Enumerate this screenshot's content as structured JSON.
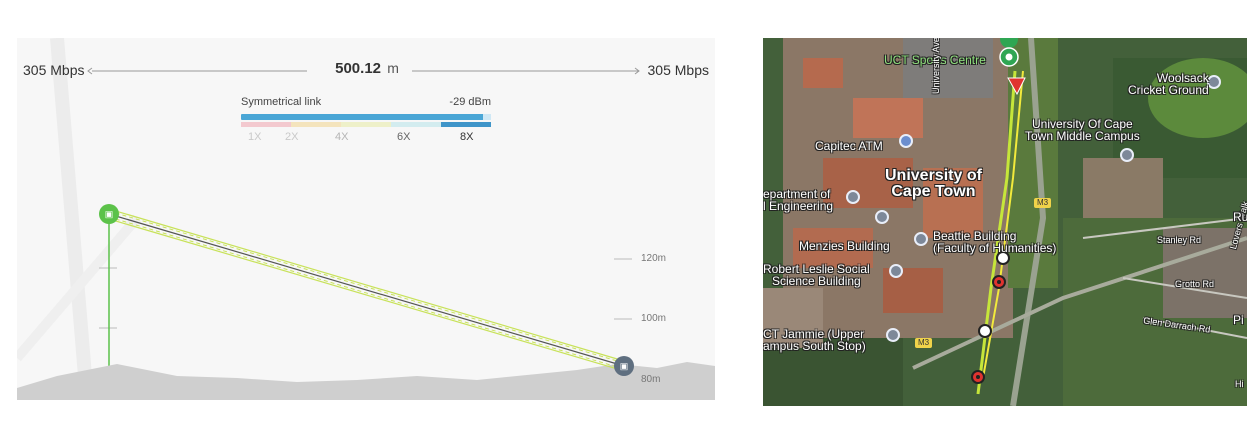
{
  "link": {
    "rate_left": "305 Mbps",
    "rate_right": "305 Mbps",
    "distance": "500.12",
    "distance_unit": "m",
    "link_type": "Symmetrical link",
    "signal": "-29 dBm",
    "modulation_levels": [
      "1X",
      "2X",
      "4X",
      "6X",
      "8X"
    ],
    "active_modulation": "8X",
    "altitude_labels": [
      "120m",
      "100m",
      "80m"
    ]
  },
  "colors": {
    "station_a": "#5cc24a",
    "station_b": "#5f6f80",
    "signal_bar": "#4aa6d6",
    "path_line": "#c8e25a"
  },
  "map": {
    "labels": {
      "sports_centre": "UCT Sports Centre",
      "woolsack": "Woolsack\nCricket Ground",
      "middle_campus": "University Of Cape\nTown Middle Campus",
      "capitec": "Capitec ATM",
      "uct": "University of\nCape Town",
      "dept": "epartment of\nl Engineering",
      "beattie": "Beattie Building\n(Faculty of Humanities)",
      "menzies": "Menzies Building",
      "robert_leslie": "Robert Leslie Social\nScience Building",
      "jammie": "CT Jammie (Upper\nampus South Stop)",
      "university_ave": "University Ave N",
      "stanley": "Stanley Rd",
      "grotto": "Grotto Rd",
      "glen_darrach": "Glen Darrach Rd",
      "lovers_walk": "Lovers Walk",
      "ru": "Ru",
      "pi": "Pi",
      "hi": "Hi",
      "m3_a": "M3",
      "m3_b": "M3"
    }
  }
}
